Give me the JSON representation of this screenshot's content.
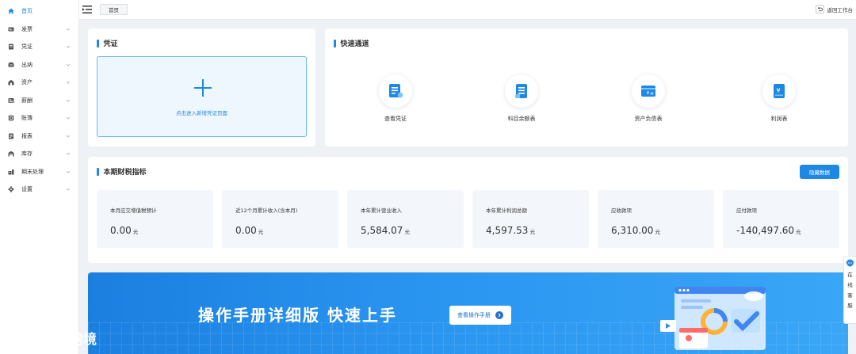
{
  "sidebar": {
    "items": [
      {
        "label": "首页",
        "icon": "home-icon",
        "active": true,
        "has_chevron": false
      },
      {
        "label": "发票",
        "icon": "invoice-icon",
        "active": false,
        "has_chevron": true
      },
      {
        "label": "凭证",
        "icon": "voucher-icon",
        "active": false,
        "has_chevron": true
      },
      {
        "label": "出纳",
        "icon": "cashier-icon",
        "active": false,
        "has_chevron": true
      },
      {
        "label": "资产",
        "icon": "asset-icon",
        "active": false,
        "has_chevron": true
      },
      {
        "label": "薪酬",
        "icon": "salary-icon",
        "active": false,
        "has_chevron": true
      },
      {
        "label": "账簿",
        "icon": "ledger-icon",
        "active": false,
        "has_chevron": true
      },
      {
        "label": "报表",
        "icon": "report-icon",
        "active": false,
        "has_chevron": true
      },
      {
        "label": "库存",
        "icon": "inventory-icon",
        "active": false,
        "has_chevron": true
      },
      {
        "label": "期末处理",
        "icon": "period-end-icon",
        "active": false,
        "has_chevron": true
      },
      {
        "label": "设置",
        "icon": "gear-icon",
        "active": false,
        "has_chevron": true
      }
    ]
  },
  "topbar": {
    "tab_label": "首页",
    "back_label": "返回工作台"
  },
  "voucher_card": {
    "title": "凭证",
    "add_text": "点击进入新增凭证页面"
  },
  "quick_card": {
    "title": "快速通道",
    "items": [
      {
        "label": "查看凭证",
        "icon": "view-voucher-icon"
      },
      {
        "label": "科目余额表",
        "icon": "account-balance-icon"
      },
      {
        "label": "资产负债表",
        "icon": "balance-sheet-icon"
      },
      {
        "label": "利润表",
        "icon": "profit-statement-icon"
      }
    ]
  },
  "indicators_card": {
    "title": "本期财税指标",
    "hide_button": "隐藏数据",
    "items": [
      {
        "label": "本月应交增值税预计",
        "value": "0.00",
        "unit": "元"
      },
      {
        "label": "近12个月累计收入(含本月)",
        "value": "0.00",
        "unit": "元"
      },
      {
        "label": "本年累计营业收入",
        "value": "5,584.07",
        "unit": "元"
      },
      {
        "label": "本年累计利润总额",
        "value": "4,597.53",
        "unit": "元"
      },
      {
        "label": "应收款项",
        "value": "6,310.00",
        "unit": "元"
      },
      {
        "label": "应付款项",
        "value": "-140,497.60",
        "unit": "元"
      }
    ]
  },
  "banner": {
    "title": "操作手册详细版  快速上手",
    "button": "查看操作手册"
  },
  "watermark": {
    "text": "大数跨境"
  },
  "float_service": {
    "text": "在线客服"
  },
  "colors": {
    "accent": "#1e88e5",
    "banner_start": "#1b7fe0",
    "banner_end": "#3aa6f6",
    "indicator_bg": "#f3f6fb"
  }
}
